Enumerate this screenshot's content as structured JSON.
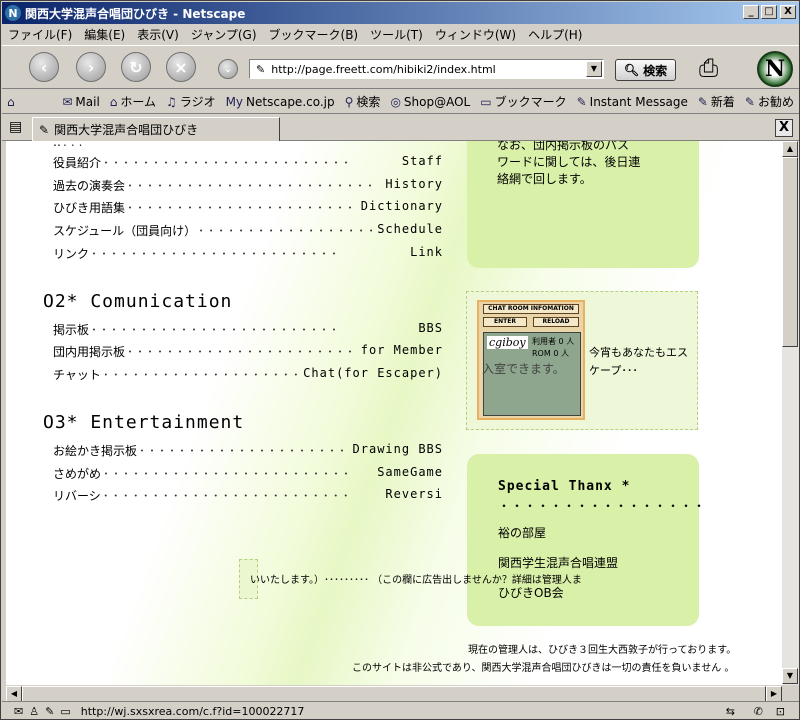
{
  "window": {
    "title": "関西大学混声合唱団ひびき - Netscape",
    "minimize": "_",
    "maximize": "□",
    "close": "X"
  },
  "menu": [
    "ファイル(F)",
    "編集(E)",
    "表示(V)",
    "ジャンプ(G)",
    "ブックマーク(B)",
    "ツール(T)",
    "ウィンドウ(W)",
    "ヘルプ(H)"
  ],
  "toolbar": {
    "url": "http://page.freett.com/hibiki2/index.html",
    "search_label": "検索",
    "logo_letter": "N"
  },
  "personal_bar": [
    "Mail",
    "ホーム",
    "ラジオ",
    "Netscape.co.jp",
    "検索",
    "Shop@AOL",
    "ブックマーク",
    "Instant Message",
    "新着",
    "お勧め"
  ],
  "tab": {
    "title": "関西大学混声合唱団ひびき",
    "close": "X"
  },
  "nav": {
    "top_cut": "...",
    "items1": [
      {
        "jp": "役員紹介",
        "en": "Staff"
      },
      {
        "jp": "過去の演奏会",
        "en": "History"
      },
      {
        "jp": "ひびき用語集",
        "en": "Dictionary"
      },
      {
        "jp": "スケジュール（団員向け）",
        "en": "Schedule"
      },
      {
        "jp": "リンク",
        "en": "Link"
      }
    ],
    "section2": "O2* Comunication",
    "items2": [
      {
        "jp": "掲示板",
        "en": "BBS"
      },
      {
        "jp": "団内用掲示板",
        "en": "for Member"
      },
      {
        "jp": "チャット",
        "en": "Chat(for Escaper)"
      }
    ],
    "section3": "O3* Entertainment",
    "items3": [
      {
        "jp": "お絵かき掲示板",
        "en": "Drawing BBS"
      },
      {
        "jp": "さめがめ",
        "en": "SameGame"
      },
      {
        "jp": "リバーシ",
        "en": "Reversi"
      }
    ]
  },
  "notice": {
    "line1": "なお、団内掲示板のパス",
    "line2": "ワードに関しては、後日連",
    "line3": "絡網で回します。"
  },
  "chat": {
    "widget_title": "CHAT ROOM INFOMATION",
    "enter": "ENTER",
    "reload": "RELOAD",
    "brand": "cgiboy",
    "users_label": "利用者",
    "users_value": "0",
    "users_unit": "人",
    "rom_label": "ROM",
    "rom_value": "0",
    "rom_unit": "人",
    "line1": "今宵もあなたもエス",
    "line2": "ケープ･･･",
    "line3": "入室できます。"
  },
  "thanks": {
    "title": "Special Thanx *",
    "dots": "・・・・・・・・・・・・・・・・",
    "item1": "裕の部屋",
    "item2": "関西学生混声合唱連盟",
    "item3": "ひびきOB会"
  },
  "ad": {
    "text": "いいたします。）･････････ （この欄に広告出しませんか？詳細は管理人ま"
  },
  "footer": {
    "line1": "現在の管理人は、ひびき３回生大西敦子が行っております。",
    "line2": "このサイトは非公式であり、関西大学混声合唱団ひびきは一切の責任を負いません 。"
  },
  "status": {
    "url": "http://wj.sxsxrea.com/c.f?id=100022717"
  }
}
